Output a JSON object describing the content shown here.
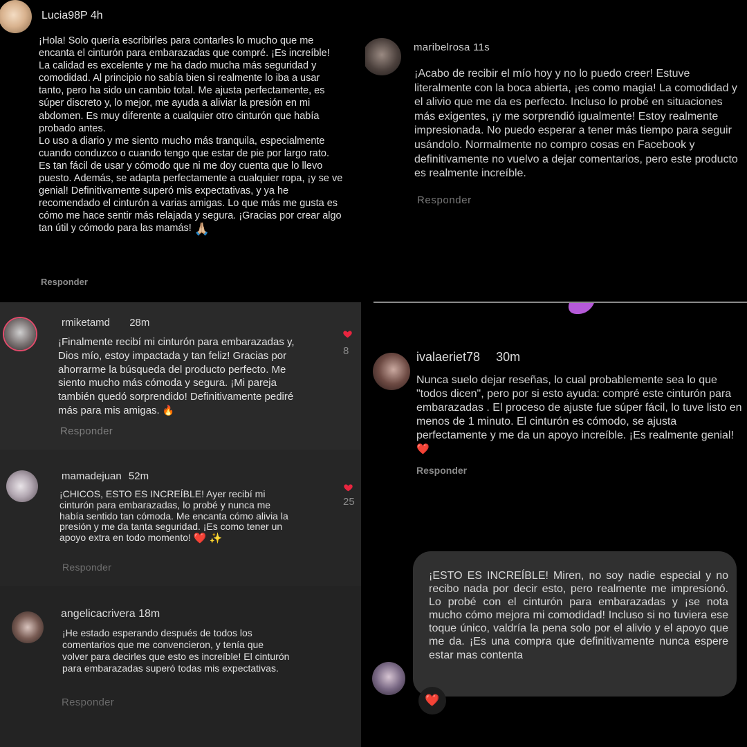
{
  "comments": [
    {
      "username": "Lucia98P",
      "time": "4h",
      "text": "¡Hola! Solo quería escribirles para contarles lo mucho que me encanta el cinturón para embarazadas que compré. ¡Es increíble! La calidad es excelente y me ha dado mucha más seguridad y comodidad. Al principio no sabía bien si realmente lo iba a usar tanto, pero ha sido un cambio total. Me ajusta perfectamente, es súper discreto y, lo mejor, me ayuda a aliviar la presión en mi abdomen. Es muy diferente a cualquier otro cinturón que había probado antes.\nLo uso a diario y me siento mucho más tranquila, especialmente cuando conduzco o cuando tengo que estar de pie por largo rato. Es tan fácil de usar y cómodo que ni me doy cuenta que lo llevo puesto. Además, se adapta perfectamente a cualquier ropa, ¡y se ve genial! Definitivamente superó mis expectativas, y ya he recomendado el cinturón a varias amigas. Lo que más me gusta es cómo me hace sentir más relajada y segura. ¡Gracias por crear algo tan útil y cómodo para las mamás!",
      "emoji": "🙏🏼",
      "reply": "Responder"
    },
    {
      "username": "maribelrosa",
      "time": "11s",
      "text": "¡Acabo de recibir el mío hoy y no lo puedo creer!  Estuve literalmente con la boca abierta, ¡es como magia! La comodidad y el alivio que me da es perfecto. Incluso lo probé en situaciones más exigentes, ¡y me sorprendió igualmente! Estoy realmente impresionada. No puedo esperar a tener más tiempo para seguir usándolo. Normalmente no compro cosas en Facebook y definitivamente no vuelvo a dejar comentarios, pero este producto es realmente increíble.",
      "reply": "Responder"
    },
    {
      "username": "rmiketamd",
      "time": "28m",
      "text": "¡Finalmente recibí mi cinturón para embarazadas y, Dios mío, estoy impactada y tan feliz! Gracias por ahorrarme la búsqueda del producto perfecto. Me siento mucho más cómoda y segura. ¡Mi pareja también quedó sorprendido! Definitivamente pediré más para mis amigas.",
      "emoji": "🔥",
      "likes": "8",
      "reply": "Responder"
    },
    {
      "username": "ivalaeriet78",
      "time": "30m",
      "text": "Nunca suelo dejar reseñas, lo cual probablemente sea lo que \"todos dicen\", pero por si esto ayuda: compré este cinturón para embarazadas . El proceso de ajuste fue súper fácil, lo tuve listo en menos de 1 minuto. El cinturón es cómodo, se ajusta perfectamente y me da un apoyo increíble. ¡Es realmente genial!",
      "emoji": "❤️",
      "reply": "Responder"
    },
    {
      "username": "mamadejuan",
      "time": "52m",
      "text": "¡CHICOS, ESTO ES INCREÍBLE! Ayer recibí mi cinturón para embarazadas, lo probé y nunca me había sentido tan cómoda. Me encanta cómo alivia la presión y me da tanta seguridad. ¡Es como tener un apoyo extra en todo momento!",
      "emoji": "❤️ ✨",
      "likes": "25",
      "reply": "Responder"
    },
    {
      "username": "angelicacrivera",
      "time": "18m",
      "text": "¡He estado esperando después de todos los comentarios que me convencieron, y tenía que volver para decirles que esto es increíble! El cinturón para embarazadas superó todas mis expectativas.",
      "reply": "Responder"
    },
    {
      "text": "¡ESTO ES INCREÍBLE! Miren, no soy nadie especial y no recibo nada por decir esto, pero realmente me impresionó. Lo probé con el cinturón para embarazadas y ¡se nota mucho cómo mejora mi comodidad! Incluso si no tuviera ese toque único, valdría la pena solo por el alivio y el apoyo que me da. ¡Es una compra que definitivamente nunca espere estar mas contenta",
      "reaction": "❤️"
    }
  ],
  "colors": {
    "heart": "#e8253f",
    "dark_panel": "#2a2a2a",
    "bubble": "#303030"
  }
}
